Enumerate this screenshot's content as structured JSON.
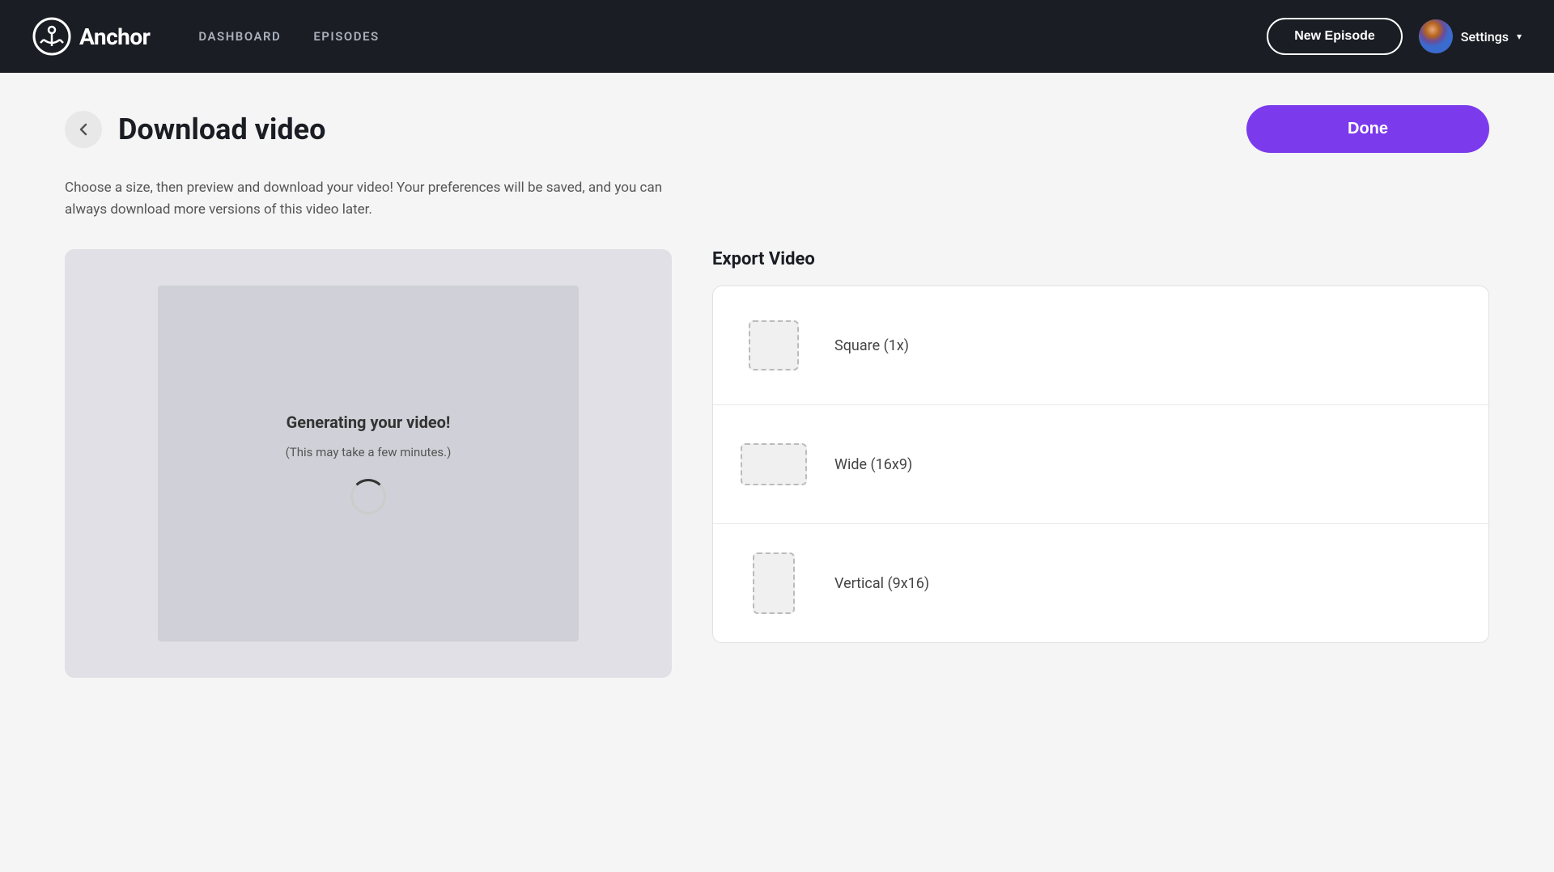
{
  "header": {
    "logo_text": "Anchor",
    "logo_trademark": "®",
    "nav": [
      {
        "id": "dashboard",
        "label": "DASHBOARD"
      },
      {
        "id": "episodes",
        "label": "EPISODES"
      }
    ],
    "new_episode_label": "New Episode",
    "settings_label": "Settings"
  },
  "page": {
    "back_button_label": "←",
    "title": "Download video",
    "done_button_label": "Done",
    "description": "Choose a size, then preview and download your video! Your preferences will be saved, and you can always download more versions of this video later."
  },
  "preview": {
    "generating_text": "Generating your video!",
    "generating_sub": "(This may take a few minutes.)"
  },
  "export": {
    "title": "Export Video",
    "options": [
      {
        "id": "square",
        "label": "Square (1x)",
        "shape": "square"
      },
      {
        "id": "wide",
        "label": "Wide (16x9)",
        "shape": "wide"
      },
      {
        "id": "vertical",
        "label": "Vertical (9x16)",
        "shape": "vertical"
      }
    ]
  }
}
